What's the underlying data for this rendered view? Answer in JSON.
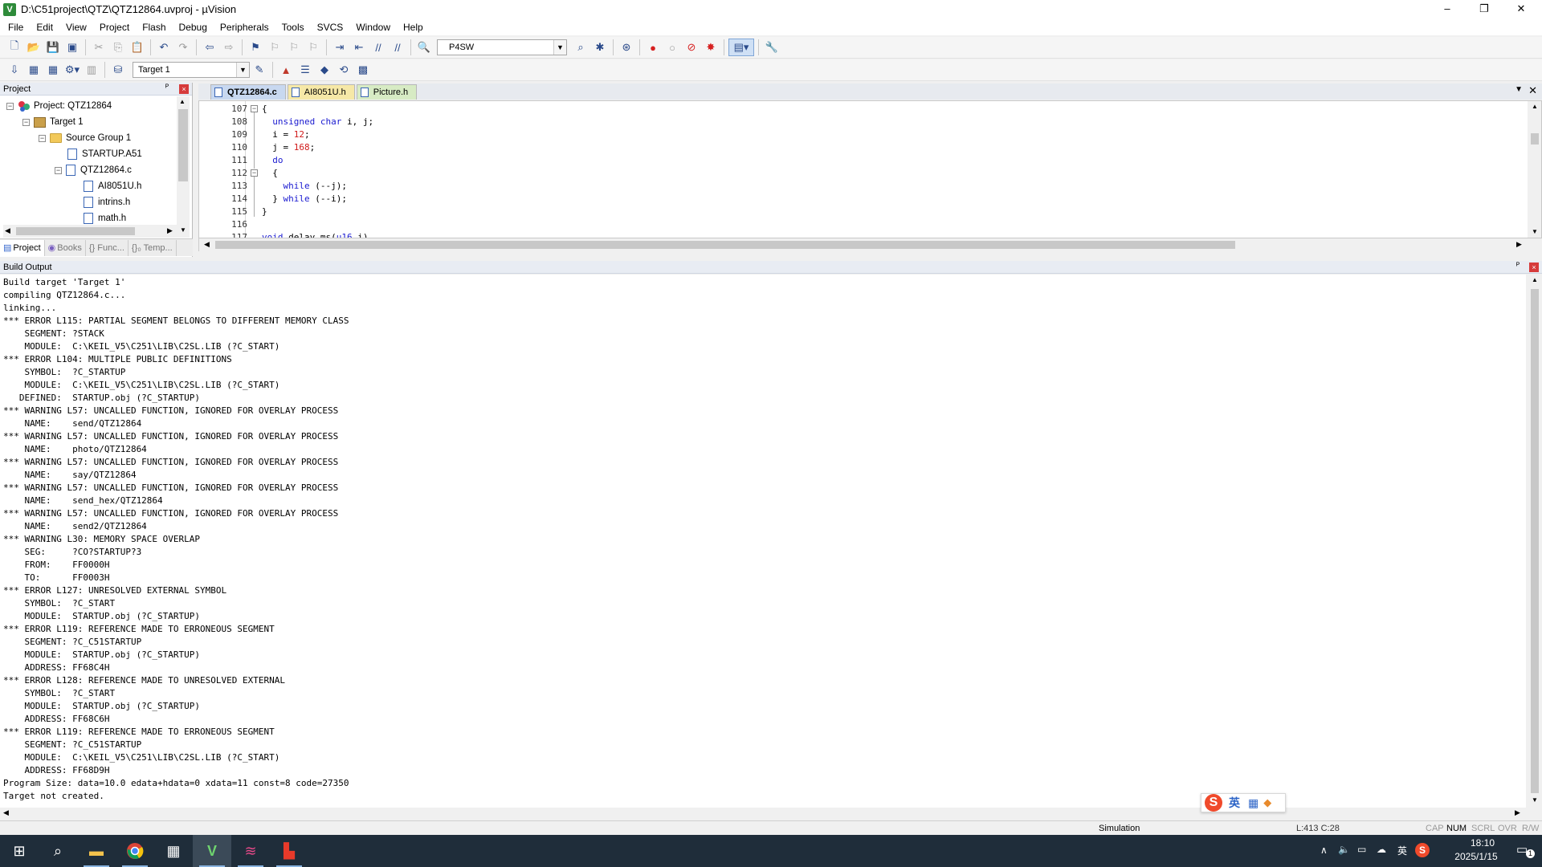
{
  "window": {
    "title": "D:\\C51project\\QTZ\\QTZ12864.uvproj - µVision",
    "app_icon": "V",
    "min_label": "–",
    "restore_label": "❐",
    "close_label": "✕"
  },
  "menu": [
    "File",
    "Edit",
    "View",
    "Project",
    "Flash",
    "Debug",
    "Peripherals",
    "Tools",
    "SVCS",
    "Window",
    "Help"
  ],
  "toolbar": {
    "find_combo_value": "P4SW",
    "target_combo_value": "Target 1"
  },
  "project_pane": {
    "title": "Project",
    "pin": "ᴾ",
    "close": "×",
    "tree": [
      {
        "label": "Project: QTZ12864",
        "type": "project",
        "expander": "−"
      },
      {
        "label": "Target 1",
        "type": "target",
        "expander": "−"
      },
      {
        "label": "Source Group 1",
        "type": "folder",
        "expander": "−"
      },
      {
        "label": "STARTUP.A51",
        "type": "file",
        "expander": ""
      },
      {
        "label": "QTZ12864.c",
        "type": "file",
        "expander": "−"
      },
      {
        "label": "AI8051U.h",
        "type": "file",
        "expander": ""
      },
      {
        "label": "intrins.h",
        "type": "file",
        "expander": ""
      },
      {
        "label": "math.h",
        "type": "file",
        "expander": ""
      }
    ],
    "tabs": [
      "Project",
      "Books",
      "{} Func...",
      "{}₀ Temp..."
    ]
  },
  "editor": {
    "tabs": [
      "QTZ12864.c",
      "AI8051U.h",
      "Picture.h"
    ],
    "active_tab": 0,
    "lines": [
      {
        "num": "107",
        "code": "{"
      },
      {
        "num": "108",
        "code": "  unsigned char i, j;"
      },
      {
        "num": "109",
        "code": "  i = 12;"
      },
      {
        "num": "110",
        "code": "  j = 168;"
      },
      {
        "num": "111",
        "code": "  do"
      },
      {
        "num": "112",
        "code": "  {"
      },
      {
        "num": "113",
        "code": "    while (--j);"
      },
      {
        "num": "114",
        "code": "  } while (--i);"
      },
      {
        "num": "115",
        "code": "}"
      },
      {
        "num": "116",
        "code": ""
      },
      {
        "num": "117",
        "code": "void delay_ms(u16 i)"
      }
    ]
  },
  "build": {
    "title": "Build Output",
    "lines": [
      "Build target 'Target 1'",
      "compiling QTZ12864.c...",
      "linking...",
      "*** ERROR L115: PARTIAL SEGMENT BELONGS TO DIFFERENT MEMORY CLASS",
      "    SEGMENT: ?STACK",
      "    MODULE:  C:\\KEIL_V5\\C251\\LIB\\C2SL.LIB (?C_START)",
      "*** ERROR L104: MULTIPLE PUBLIC DEFINITIONS",
      "    SYMBOL:  ?C_STARTUP",
      "    MODULE:  C:\\KEIL_V5\\C251\\LIB\\C2SL.LIB (?C_START)",
      "   DEFINED:  STARTUP.obj (?C_STARTUP)",
      "*** WARNING L57: UNCALLED FUNCTION, IGNORED FOR OVERLAY PROCESS",
      "    NAME:    send/QTZ12864",
      "*** WARNING L57: UNCALLED FUNCTION, IGNORED FOR OVERLAY PROCESS",
      "    NAME:    photo/QTZ12864",
      "*** WARNING L57: UNCALLED FUNCTION, IGNORED FOR OVERLAY PROCESS",
      "    NAME:    say/QTZ12864",
      "*** WARNING L57: UNCALLED FUNCTION, IGNORED FOR OVERLAY PROCESS",
      "    NAME:    send_hex/QTZ12864",
      "*** WARNING L57: UNCALLED FUNCTION, IGNORED FOR OVERLAY PROCESS",
      "    NAME:    send2/QTZ12864",
      "*** WARNING L30: MEMORY SPACE OVERLAP",
      "    SEG:     ?CO?STARTUP?3",
      "    FROM:    FF0000H",
      "    TO:      FF0003H",
      "*** ERROR L127: UNRESOLVED EXTERNAL SYMBOL",
      "    SYMBOL:  ?C_START",
      "    MODULE:  STARTUP.obj (?C_STARTUP)",
      "*** ERROR L119: REFERENCE MADE TO ERRONEOUS SEGMENT",
      "    SEGMENT: ?C_C51STARTUP",
      "    MODULE:  STARTUP.obj (?C_STARTUP)",
      "    ADDRESS: FF68C4H",
      "*** ERROR L128: REFERENCE MADE TO UNRESOLVED EXTERNAL",
      "    SYMBOL:  ?C_START",
      "    MODULE:  STARTUP.obj (?C_STARTUP)",
      "    ADDRESS: FF68C6H",
      "*** ERROR L119: REFERENCE MADE TO ERRONEOUS SEGMENT",
      "    SEGMENT: ?C_C51STARTUP",
      "    MODULE:  C:\\KEIL_V5\\C251\\LIB\\C2SL.LIB (?C_START)",
      "    ADDRESS: FF68D9H",
      "Program Size: data=10.0 edata+hdata=0 xdata=11 const=8 code=27350",
      "Target not created."
    ]
  },
  "ime": {
    "logo": "S",
    "lang": "英"
  },
  "status": {
    "mode": "Simulation",
    "position": "L:413 C:28",
    "caps": "CAP",
    "num": "NUM",
    "scrl": "SCRL",
    "ovr": "OVR",
    "rw": "R/W"
  },
  "taskbar": {
    "time": "18:10",
    "date": "2025/1/15",
    "ime_label": "英",
    "notif": "1"
  }
}
